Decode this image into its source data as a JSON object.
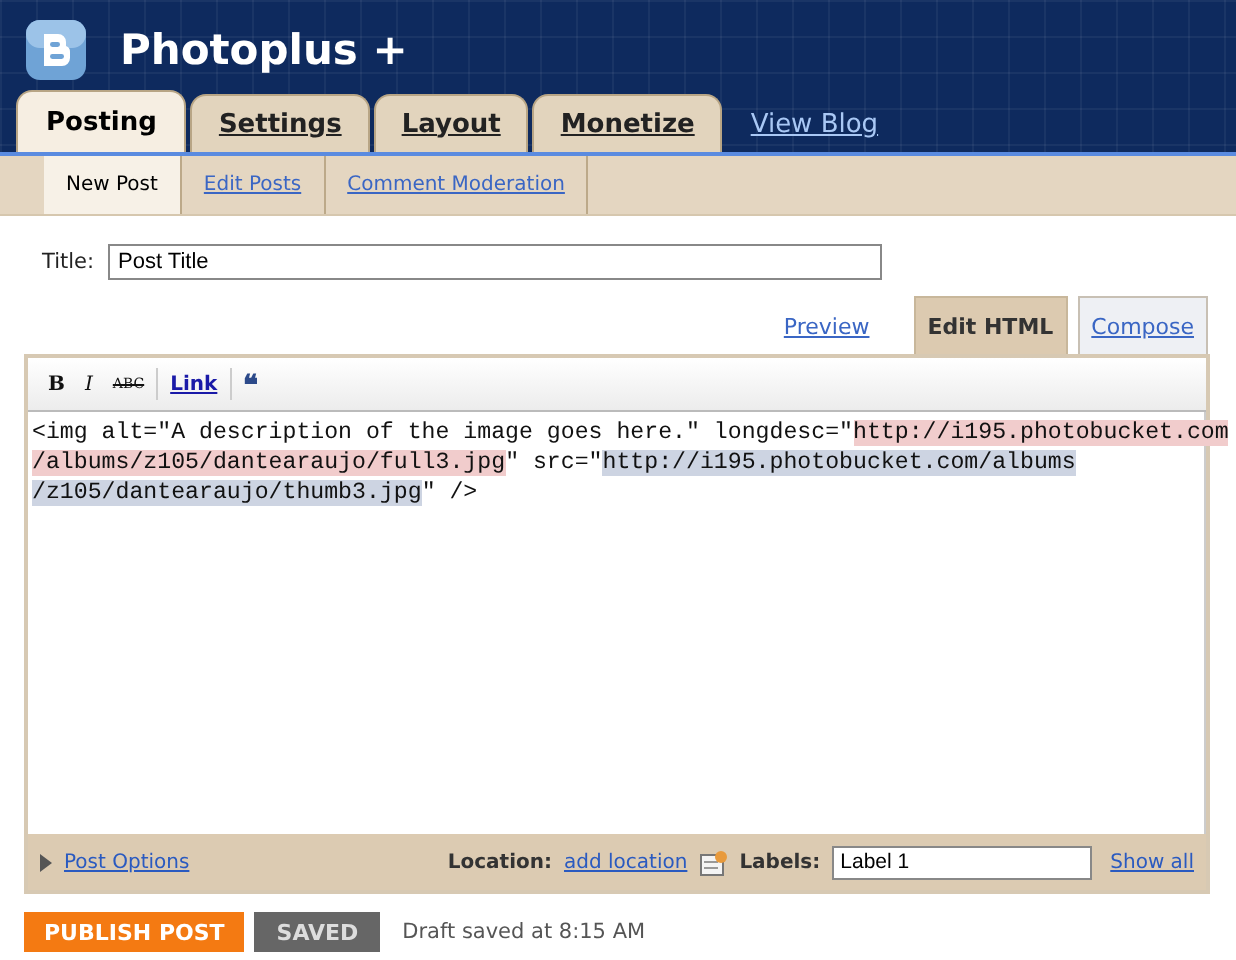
{
  "blog": {
    "title": "Photoplus +"
  },
  "tabs": [
    {
      "label": "Posting",
      "selected": true
    },
    {
      "label": "Settings",
      "selected": false
    },
    {
      "label": "Layout",
      "selected": false
    },
    {
      "label": "Monetize",
      "selected": false
    }
  ],
  "view_blog": "View Blog",
  "subtabs": [
    {
      "label": "New Post",
      "selected": true
    },
    {
      "label": "Edit Posts",
      "selected": false
    },
    {
      "label": "Comment Moderation",
      "selected": false
    }
  ],
  "title_field": {
    "label": "Title:",
    "value": "Post Title"
  },
  "modes": [
    {
      "label": "Preview",
      "kind": "link",
      "selected": false
    },
    {
      "label": "Edit HTML",
      "kind": "tab",
      "selected": true
    },
    {
      "label": "Compose",
      "kind": "tab",
      "selected": false
    }
  ],
  "toolbar": [
    {
      "kind": "bold",
      "label": "B"
    },
    {
      "kind": "italic",
      "label": "I"
    },
    {
      "kind": "strike",
      "label": "ABC"
    },
    {
      "kind": "link",
      "label": "Link"
    },
    {
      "kind": "quote",
      "label": "❝"
    }
  ],
  "code_lines": [
    [
      {
        "kind": "plain",
        "text": "<img alt=\"A description of the image goes here.\" longdesc=\""
      },
      {
        "kind": "pink",
        "text": "http://i195.photobucket.com"
      }
    ],
    [
      {
        "kind": "pink",
        "text": "/albums/z105/dantearaujo/full3.jpg"
      },
      {
        "kind": "plain",
        "text": "\" src=\""
      },
      {
        "kind": "blue",
        "text": "http://i195.photobucket.com/albums"
      }
    ],
    [
      {
        "kind": "blue",
        "text": "/z105/dantearaujo/thumb3.jpg"
      },
      {
        "kind": "plain",
        "text": "\" />"
      }
    ]
  ],
  "footer": {
    "post_options": "Post Options",
    "location_label": "Location:",
    "add_location": "add location",
    "labels_label": "Labels:",
    "labels_value": "Label 1",
    "show_all": "Show all"
  },
  "actions": {
    "publish": "PUBLISH POST",
    "saved": "SAVED",
    "status": "Draft saved at 8:15 AM"
  }
}
